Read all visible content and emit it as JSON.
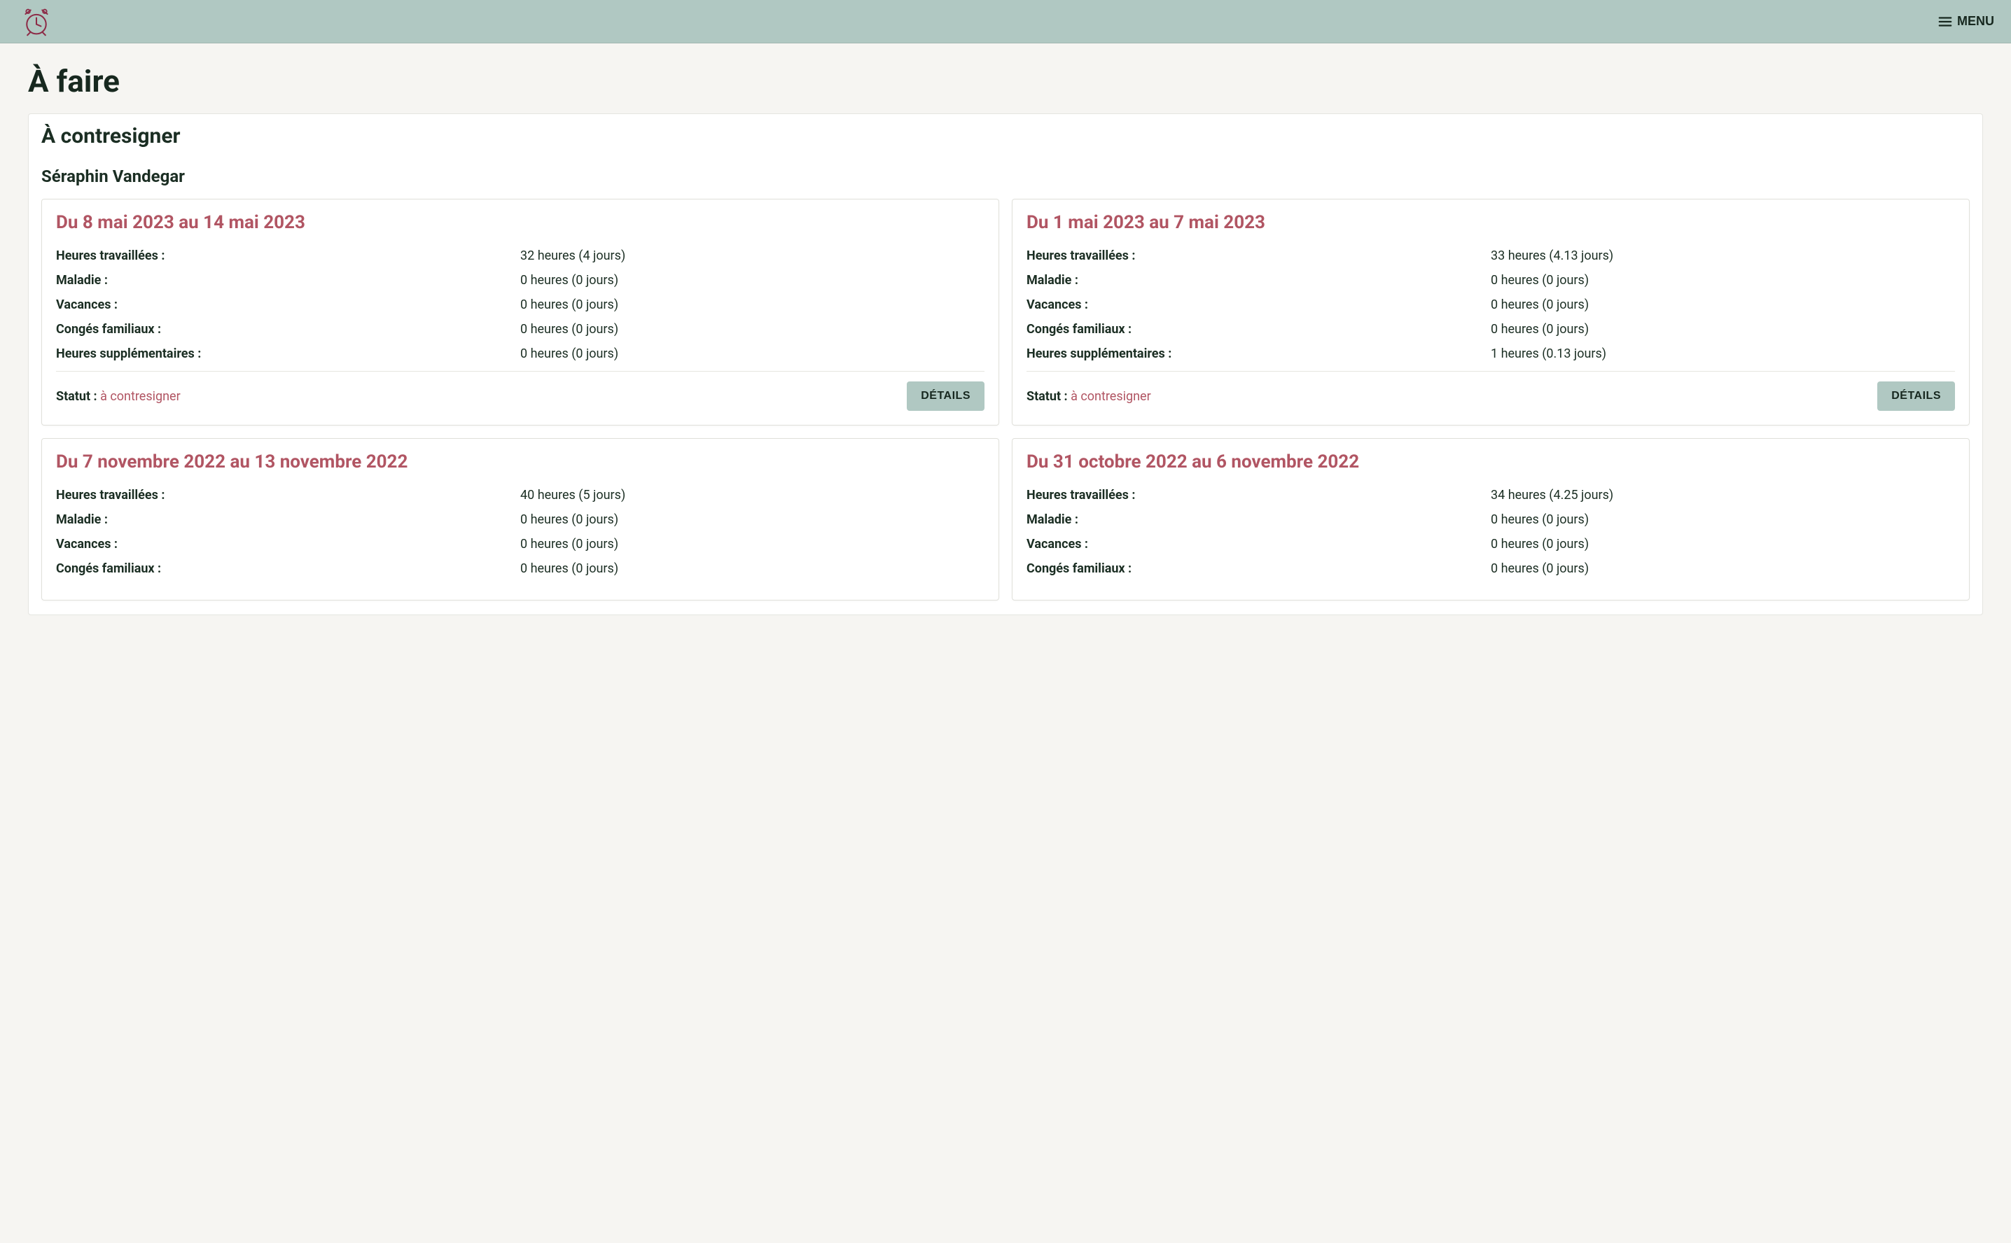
{
  "header": {
    "menu_label": "MENU"
  },
  "page": {
    "title": "À faire",
    "section_title": "À contresigner",
    "person_name": "Séraphin Vandegar"
  },
  "labels": {
    "worked": "Heures travaillées :",
    "sick": "Maladie :",
    "vacation": "Vacances :",
    "family": "Congés familiaux :",
    "overtime": "Heures supplémentaires :",
    "status": "Statut :",
    "details_btn": "DÉTAILS"
  },
  "cards": [
    {
      "title": "Du 8 mai 2023 au 14 mai 2023",
      "worked": "32 heures (4 jours)",
      "sick": "0 heures (0 jours)",
      "vacation": "0 heures (0 jours)",
      "family": "0 heures (0 jours)",
      "overtime": "0 heures (0 jours)",
      "status": "à contresigner",
      "show_footer": true
    },
    {
      "title": "Du 1 mai 2023 au 7 mai 2023",
      "worked": "33 heures (4.13 jours)",
      "sick": "0 heures (0 jours)",
      "vacation": "0 heures (0 jours)",
      "family": "0 heures (0 jours)",
      "overtime": "1 heures (0.13 jours)",
      "status": "à contresigner",
      "show_footer": true
    },
    {
      "title": "Du 7 novembre 2022 au 13 novembre 2022",
      "worked": "40 heures (5 jours)",
      "sick": "0 heures (0 jours)",
      "vacation": "0 heures (0 jours)",
      "family": "0 heures (0 jours)",
      "overtime": "",
      "status": "",
      "show_footer": false
    },
    {
      "title": "Du 31 octobre 2022 au 6 novembre 2022",
      "worked": "34 heures (4.25 jours)",
      "sick": "0 heures (0 jours)",
      "vacation": "0 heures (0 jours)",
      "family": "0 heures (0 jours)",
      "overtime": "",
      "status": "",
      "show_footer": false
    }
  ]
}
